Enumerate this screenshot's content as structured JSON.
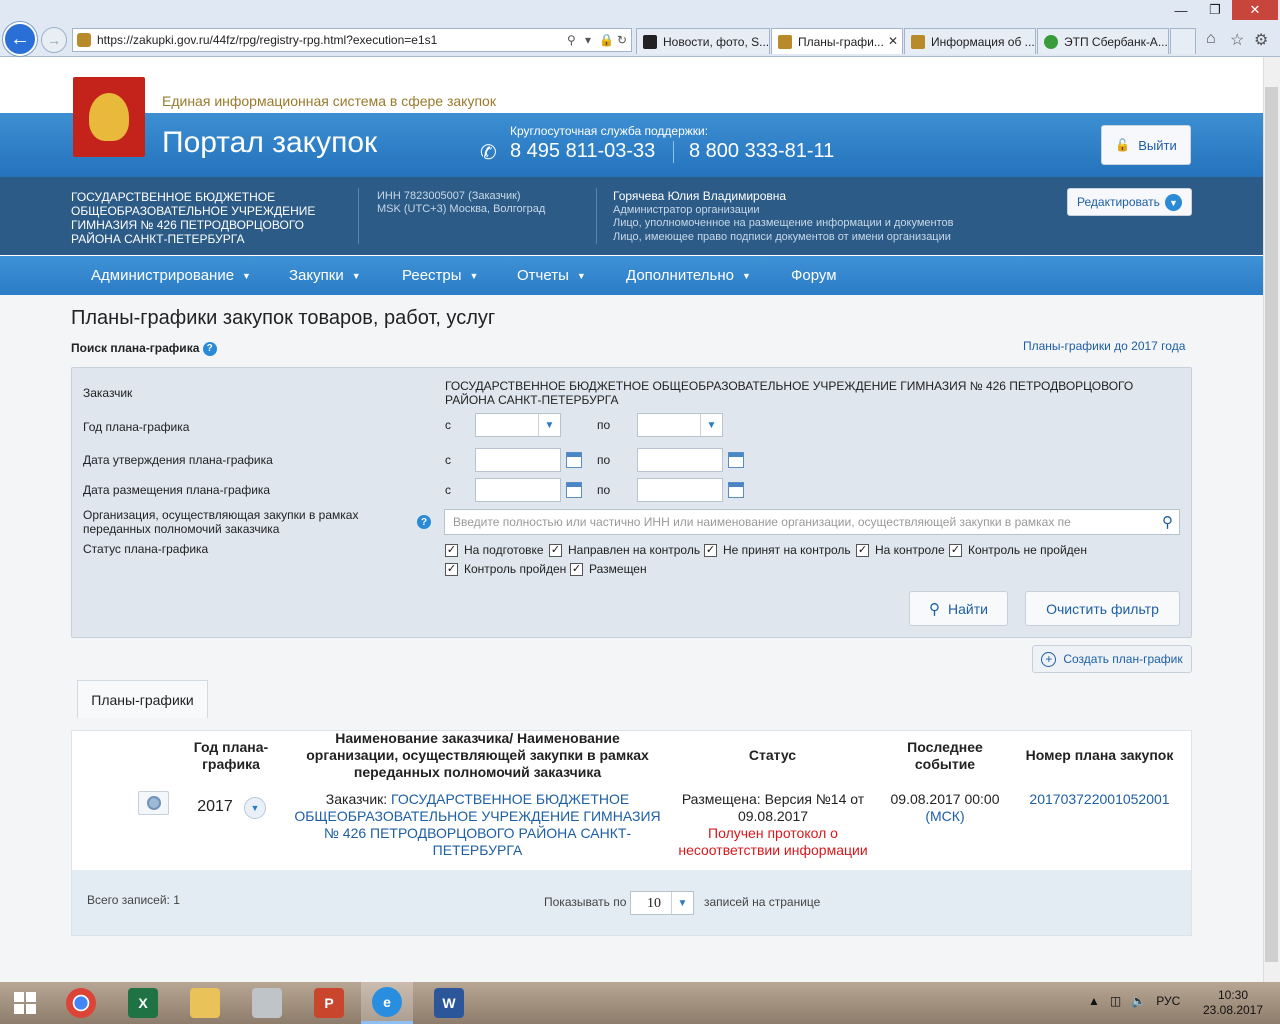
{
  "browser": {
    "url": "https://zakupki.gov.ru/44fz/rpg/registry-rpg.html?execution=e1s1",
    "tabs": [
      {
        "label": "Новости, фото, S...",
        "active": false,
        "color": "#222222"
      },
      {
        "label": "Планы-графи...",
        "active": true,
        "color": "#b88a2a"
      },
      {
        "label": "Информация об ...",
        "active": false,
        "color": "#b88a2a"
      },
      {
        "label": "ЭТП Сбербанк-А...",
        "active": false,
        "color": "#3a9b3a"
      }
    ],
    "icons": [
      "back-icon",
      "forward-icon",
      "search-icon",
      "lock-icon",
      "refresh-icon",
      "home-icon",
      "star-icon",
      "gear-icon"
    ]
  },
  "header": {
    "eis_title": "Единая информационная система в сфере закупок",
    "portal_title": "Портал закупок",
    "support_label": "Круглосуточная служба поддержки:",
    "phone1": "8 495 811-03-33",
    "phone2": "8 800 333-81-11",
    "logout_label": "Выйти"
  },
  "org": {
    "name": "ГОСУДАРСТВЕННОЕ БЮДЖЕТНОЕ ОБЩЕОБРАЗОВАТЕЛЬНОЕ УЧРЕЖДЕНИЕ ГИМНАЗИЯ № 426 ПЕТРОДВОРЦОВОГО РАЙОНА САНКТ-ПЕТЕРБУРГА",
    "inn": "ИНН 7823005007 (Заказчик)",
    "timezone": "MSK (UTC+3) Москва, Волгоград",
    "user_name": "Горячева Юлия Владимировна",
    "roles": [
      "Администратор организации",
      "Лицо, уполномоченное на размещение информации и документов",
      "Лицо, имеющее право подписи документов от имени организации"
    ],
    "edit_label": "Редактировать"
  },
  "menu": [
    {
      "label": "Администрирование",
      "dropdown": true
    },
    {
      "label": "Закупки",
      "dropdown": true
    },
    {
      "label": "Реестры",
      "dropdown": true
    },
    {
      "label": "Отчеты",
      "dropdown": true
    },
    {
      "label": "Дополнительно",
      "dropdown": true
    },
    {
      "label": "Форум",
      "dropdown": false
    }
  ],
  "page": {
    "title": "Планы-графики закупок товаров, работ, услуг",
    "search_label": "Поиск плана-графика",
    "before2017_link": "Планы-графики до 2017 года"
  },
  "filter": {
    "customer_label": "Заказчик",
    "customer_value": "ГОСУДАРСТВЕННОЕ БЮДЖЕТНОЕ ОБЩЕОБРАЗОВАТЕЛЬНОЕ УЧРЕЖДЕНИЕ ГИМНАЗИЯ № 426 ПЕТРОДВОРЦОВОГО РАЙОНА САНКТ-ПЕТЕРБУРГА",
    "year_label": "Год плана-графика",
    "approval_label": "Дата утверждения плана-графика",
    "placement_label": "Дата размещения плана-графика",
    "from": "с",
    "to": "по",
    "org_label": "Организация, осуществляющая закупки в рамках переданных полномочий заказчика",
    "org_placeholder": "Введите полностью или частично ИНН или наименование организации, осуществляющей закупки в рамках пе",
    "status_label": "Статус плана-графика",
    "statuses": [
      {
        "label": "На подготовке",
        "checked": true
      },
      {
        "label": "Направлен на контроль",
        "checked": true
      },
      {
        "label": "Не принят на контроль",
        "checked": true
      },
      {
        "label": "На контроле",
        "checked": true
      },
      {
        "label": "Контроль не пройден",
        "checked": true
      },
      {
        "label": "Контроль пройден",
        "checked": true
      },
      {
        "label": "Размещен",
        "checked": true
      }
    ],
    "find_label": "Найти",
    "clear_label": "Очистить фильтр"
  },
  "create_label": "Создать план-график",
  "tab_label": "Планы-графики",
  "table": {
    "headers": {
      "year": "Год плана-графика",
      "name": "Наименование заказчика/ Наименование организации, осуществляющей закупки в рамках переданных полномочий заказчика",
      "status": "Статус",
      "last_event": "Последнее событие",
      "plan_number": "Номер плана закупок"
    },
    "rows": [
      {
        "year": "2017",
        "customer_prefix": "Заказчик:",
        "customer": "ГОСУДАРСТВЕННОЕ БЮДЖЕТНОЕ ОБЩЕОБРАЗОВАТЕЛЬНОЕ УЧРЕЖДЕНИЕ ГИМНАЗИЯ № 426 ПЕТРОДВОРЦОВОГО РАЙОНА САНКТ-ПЕТЕРБУРГА",
        "status": "Размещена: Версия №14 от 09.08.2017",
        "status_note": "Получен протокол о несоответствии информации",
        "last_event": "09.08.2017 00:00",
        "last_event_tz": "(МСК)",
        "plan_number": "201703722001052001"
      }
    ],
    "total": "Всего записей: 1",
    "show_by": "Показывать по",
    "page_size": "10",
    "per_page": "записей на странице"
  },
  "taskbar": {
    "apps": [
      "chrome-icon",
      "excel-icon",
      "explorer-icon",
      "scanner-icon",
      "powerpoint-icon",
      "ie-icon",
      "word-icon"
    ],
    "lang": "РУС",
    "time": "10:30",
    "date": "23.08.2017"
  }
}
